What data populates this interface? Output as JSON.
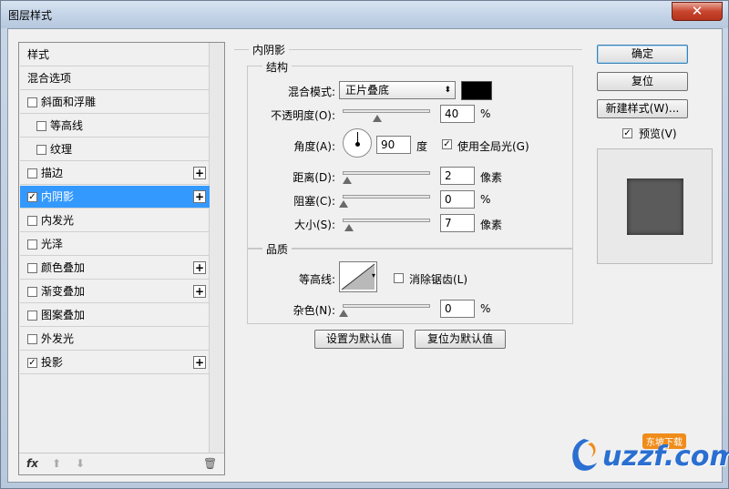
{
  "window": {
    "title": "图层样式",
    "close_glyph": "✕"
  },
  "style_list": {
    "items": [
      {
        "label": "样式",
        "checkbox": false,
        "checked": false,
        "plus": false,
        "indent": 0,
        "selected": false
      },
      {
        "label": "混合选项",
        "checkbox": false,
        "checked": false,
        "plus": false,
        "indent": 0,
        "selected": false
      },
      {
        "label": "斜面和浮雕",
        "checkbox": true,
        "checked": false,
        "plus": false,
        "indent": 0,
        "selected": false
      },
      {
        "label": "等高线",
        "checkbox": true,
        "checked": false,
        "plus": false,
        "indent": 1,
        "selected": false
      },
      {
        "label": "纹理",
        "checkbox": true,
        "checked": false,
        "plus": false,
        "indent": 1,
        "selected": false
      },
      {
        "label": "描边",
        "checkbox": true,
        "checked": false,
        "plus": true,
        "indent": 0,
        "selected": false
      },
      {
        "label": "内阴影",
        "checkbox": true,
        "checked": true,
        "plus": true,
        "indent": 0,
        "selected": true
      },
      {
        "label": "内发光",
        "checkbox": true,
        "checked": false,
        "plus": false,
        "indent": 0,
        "selected": false
      },
      {
        "label": "光泽",
        "checkbox": true,
        "checked": false,
        "plus": false,
        "indent": 0,
        "selected": false
      },
      {
        "label": "颜色叠加",
        "checkbox": true,
        "checked": false,
        "plus": true,
        "indent": 0,
        "selected": false
      },
      {
        "label": "渐变叠加",
        "checkbox": true,
        "checked": false,
        "plus": true,
        "indent": 0,
        "selected": false
      },
      {
        "label": "图案叠加",
        "checkbox": true,
        "checked": false,
        "plus": false,
        "indent": 0,
        "selected": false
      },
      {
        "label": "外发光",
        "checkbox": true,
        "checked": false,
        "plus": false,
        "indent": 0,
        "selected": false
      },
      {
        "label": "投影",
        "checkbox": true,
        "checked": true,
        "plus": true,
        "indent": 0,
        "selected": false
      }
    ],
    "footer": {
      "fx_label": "fx",
      "up_glyph": "⬆",
      "down_glyph": "⬇",
      "trash_glyph": "🗑"
    },
    "check_glyph": "✓",
    "plus_glyph": "+"
  },
  "panel": {
    "section_title": "内阴影",
    "structure": {
      "title": "结构",
      "blend_mode_label": "混合模式:",
      "blend_mode_value": "正片叠底",
      "shadow_color": "#000000",
      "opacity_label": "不透明度(O):",
      "opacity_value": "40",
      "opacity_unit": "%",
      "opacity_fraction": 0.4,
      "angle_label": "角度(A):",
      "angle_value": "90",
      "angle_unit": "度",
      "global_light_label": "使用全局光(G)",
      "global_light_checked": true,
      "distance_label": "距离(D):",
      "distance_value": "2",
      "distance_unit": "像素",
      "choke_label": "阻塞(C):",
      "choke_value": "0",
      "choke_unit": "%",
      "size_label": "大小(S):",
      "size_value": "7",
      "size_unit": "像素"
    },
    "quality": {
      "title": "品质",
      "contour_label": "等高线:",
      "anti_alias_label": "消除锯齿(L)",
      "anti_alias_checked": false,
      "noise_label": "杂色(N):",
      "noise_value": "0",
      "noise_unit": "%"
    },
    "make_default_label": "设置为默认值",
    "reset_default_label": "复位为默认值"
  },
  "buttons": {
    "ok": "确定",
    "reset": "复位",
    "new_style": "新建样式(W)...",
    "preview_label": "预览(V)",
    "preview_checked": true
  },
  "watermark": {
    "text": "uzzf.com",
    "badge": "东坡下载"
  },
  "colors": {
    "accent": "#3399ff",
    "preview_fill": "#5b5b5b"
  }
}
